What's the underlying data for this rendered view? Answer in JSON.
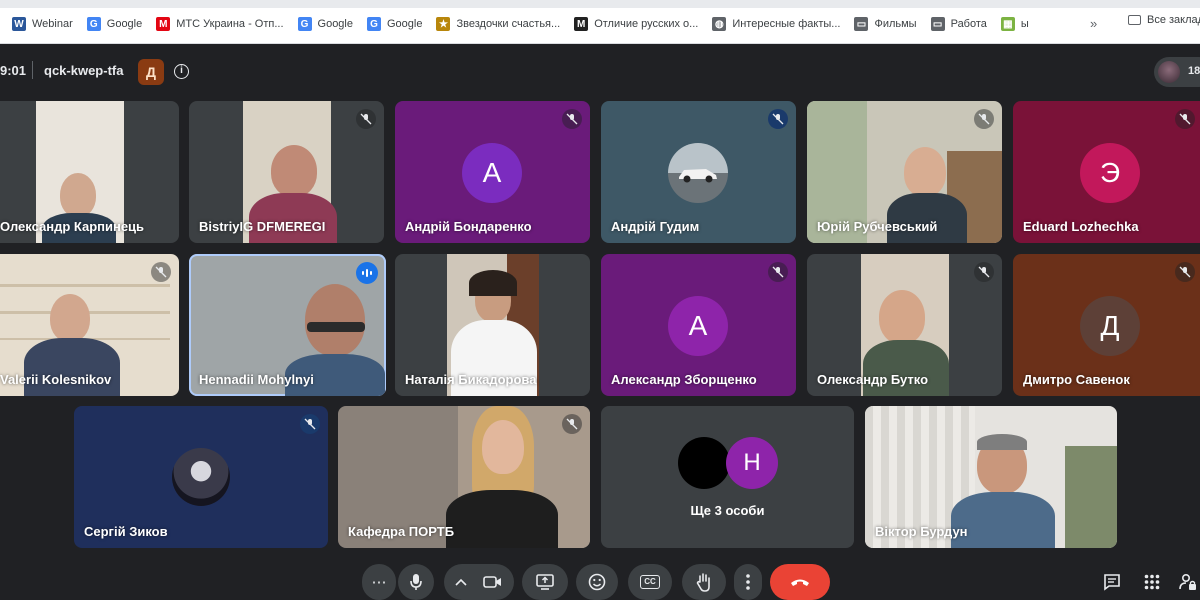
{
  "bookmarks": {
    "items": [
      {
        "label": "Webinar",
        "icon": "word-icon",
        "color": "#2b579a",
        "glyph": "W"
      },
      {
        "label": "Google",
        "icon": "google-icon",
        "color": "#4285f4",
        "glyph": "G"
      },
      {
        "label": "МТС Украина - Отп...",
        "icon": "mts-icon",
        "color": "#e30613",
        "glyph": "M"
      },
      {
        "label": "Google",
        "icon": "google-icon",
        "color": "#4285f4",
        "glyph": "G"
      },
      {
        "label": "Google",
        "icon": "google-icon",
        "color": "#4285f4",
        "glyph": "G"
      },
      {
        "label": "Звездочки счастья...",
        "icon": "image-icon",
        "color": "#b8860b",
        "glyph": "★"
      },
      {
        "label": "Отличие русских о...",
        "icon": "m-icon",
        "color": "#222222",
        "glyph": "M"
      },
      {
        "label": "Интересные факты...",
        "icon": "globe-icon",
        "color": "#5f6368",
        "glyph": "◍"
      },
      {
        "label": "Фильмы",
        "icon": "folder-icon",
        "color": "#5f6368",
        "glyph": "▭"
      },
      {
        "label": "Работа",
        "icon": "folder-icon",
        "color": "#5f6368",
        "glyph": "▭"
      },
      {
        "label": "ы",
        "icon": "basket-icon",
        "color": "#7cb342",
        "glyph": "▦"
      }
    ],
    "more": "»",
    "all_label": "Все заклад"
  },
  "header": {
    "time": "9:01",
    "meeting_code": "qck-kwep-tfa",
    "host_badge": "Д",
    "info": "i",
    "participant_count": "18"
  },
  "tiles": [
    {
      "name": "Олександр Карпинець",
      "muted": false,
      "type": "video"
    },
    {
      "name": "BistriyIG DFMEREGI",
      "muted": true,
      "type": "video"
    },
    {
      "name": "Андрій Бондаренко",
      "muted": true,
      "type": "avatar",
      "letter": "А",
      "bg": "#6a1b7a",
      "avatar": "#7b2cbf"
    },
    {
      "name": "Андрій Гудим",
      "muted": true,
      "type": "car"
    },
    {
      "name": "Юрій Рубчевський",
      "muted": true,
      "type": "video"
    },
    {
      "name": "Eduard Lozhechka",
      "muted": true,
      "type": "avatar",
      "letter": "Э",
      "bg": "#7a1238",
      "avatar": "#c2185b"
    },
    {
      "name": "Valerii Kolesnikov",
      "muted": true,
      "type": "video"
    },
    {
      "name": "Hennadii Mohylnyi",
      "muted": false,
      "speaking": true,
      "type": "video"
    },
    {
      "name": "Наталія Бикадорова",
      "muted": false,
      "type": "video"
    },
    {
      "name": "Александр Зборщенко",
      "muted": true,
      "type": "avatar",
      "letter": "А",
      "bg": "#6a1b7a",
      "avatar": "#8e24aa"
    },
    {
      "name": "Олександр Бутко",
      "muted": true,
      "type": "video"
    },
    {
      "name": "Дмитро Савенок",
      "muted": true,
      "type": "avatar",
      "letter": "Д",
      "bg": "#6b3019",
      "avatar": "#5d4037"
    },
    {
      "name": "Сергій Зиков",
      "muted": true,
      "type": "anime"
    },
    {
      "name": "Кафедра ПОРТБ",
      "muted": true,
      "type": "video"
    },
    {
      "name": "Ще 3 особи",
      "muted": false,
      "type": "others",
      "letter": "Н"
    },
    {
      "name": "Віктор Бурдун",
      "muted": false,
      "type": "video"
    }
  ],
  "controls": {
    "more_dots": "⋯",
    "mic": "mic-icon",
    "camera_chevron": "chevron-up-icon",
    "camera": "camera-icon",
    "present": "present-icon",
    "emoji": "emoji-icon",
    "captions": "CC",
    "raise_hand": "hand-icon",
    "more_options": "more-vert-icon",
    "end_call": "end-call-icon"
  }
}
